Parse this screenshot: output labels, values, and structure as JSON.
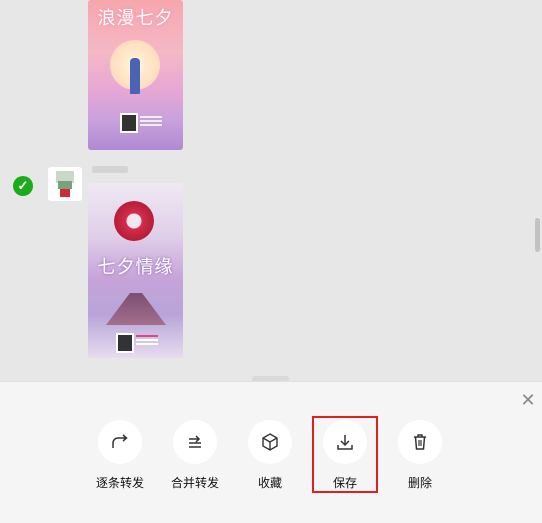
{
  "posters": [
    {
      "title": "浪漫七夕"
    },
    {
      "title": "七夕情缘"
    }
  ],
  "message": {
    "selected": true
  },
  "actions": [
    {
      "id": "forward-one-by-one",
      "label": "逐条转发",
      "icon": "share-icon"
    },
    {
      "id": "merge-forward",
      "label": "合并转发",
      "icon": "merge-forward-icon"
    },
    {
      "id": "favorite",
      "label": "收藏",
      "icon": "cube-icon"
    },
    {
      "id": "save",
      "label": "保存",
      "icon": "download-icon"
    },
    {
      "id": "delete",
      "label": "删除",
      "icon": "trash-icon"
    }
  ],
  "colors": {
    "check": "#1aad19",
    "highlight": "#e02020",
    "panel": "#f5f5f5"
  },
  "close_icon": "close-icon"
}
